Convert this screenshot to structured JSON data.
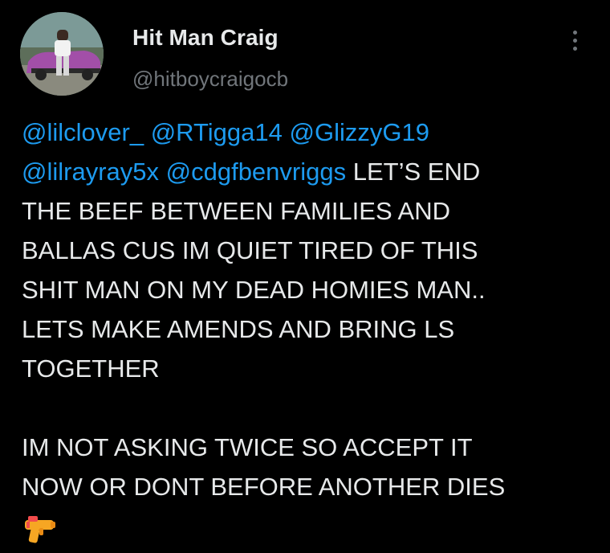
{
  "author": {
    "name": "Hit Man Craig",
    "handle": "@hitboycraigocb"
  },
  "post": {
    "mentions": [
      "@lilclover_",
      "@RTigga14",
      "@GlizzyG19",
      "@lilrayray5x",
      "@cdgfbenvriggs"
    ],
    "text_lines": [
      "LET’S END",
      "THE BEEF BETWEEN FAMILIES AND",
      "BALLAS CUS IM QUIET TIRED OF THIS",
      "SHIT MAN ON MY DEAD HOMIES MAN..",
      "LETS MAKE AMENDS AND BRING LS",
      "TOGETHER",
      "",
      "IM NOT ASKING TWICE SO ACCEPT IT",
      "NOW OR DONT BEFORE ANOTHER DIES"
    ],
    "emoji": "water-pistol-icon"
  },
  "colors": {
    "background": "#000000",
    "text": "#e7e9ea",
    "muted": "#71767b",
    "mention": "#1d9bf0"
  }
}
